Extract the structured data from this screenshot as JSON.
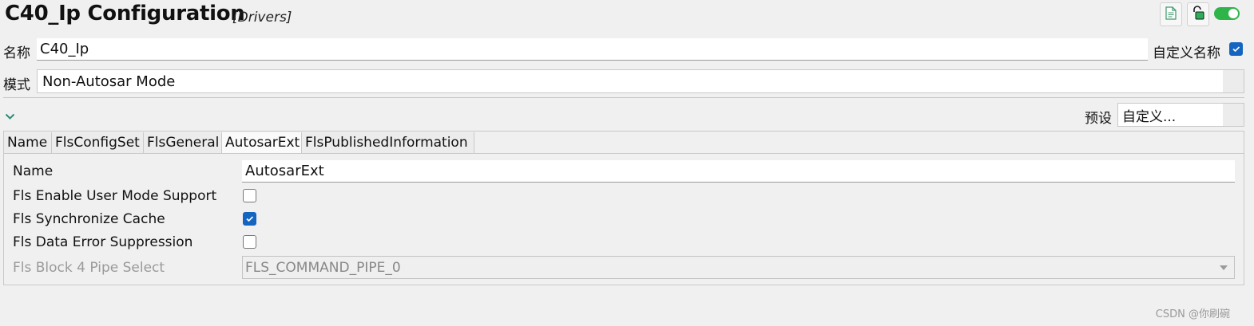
{
  "header": {
    "title": "C40_Ip Configuration",
    "subtitle": "[Drivers]",
    "icons": [
      "document-icon",
      "unlock-icon",
      "toggle-switch"
    ],
    "toggle_on": true
  },
  "name_row": {
    "label": "名称",
    "value": "C40_Ip",
    "custom_name_label": "自定义名称",
    "custom_name_checked": true
  },
  "mode_row": {
    "label": "模式",
    "value": "Non-Autosar Mode"
  },
  "preset": {
    "label": "预设",
    "value": "自定义..."
  },
  "tabs": [
    {
      "label": "Name"
    },
    {
      "label": "FlsConfigSet"
    },
    {
      "label": "FlsGeneral"
    },
    {
      "label": "AutosarExt",
      "active": true
    },
    {
      "label": "FlsPublishedInformation"
    }
  ],
  "panel": {
    "name_label": "Name",
    "name_value": "AutosarExt",
    "rows": [
      {
        "label": "Fls Enable User Mode Support",
        "checked": false
      },
      {
        "label": "Fls Synchronize Cache",
        "checked": true
      },
      {
        "label": "Fls Data Error Suppression",
        "checked": false
      }
    ],
    "pipe_label": "Fls Block 4 Pipe Select",
    "pipe_value": "FLS_COMMAND_PIPE_0"
  },
  "watermark": "CSDN @你刷碗",
  "colors": {
    "accent": "#1565c0",
    "toggle": "#2fb44a",
    "chevron": "#2e8b7a"
  }
}
